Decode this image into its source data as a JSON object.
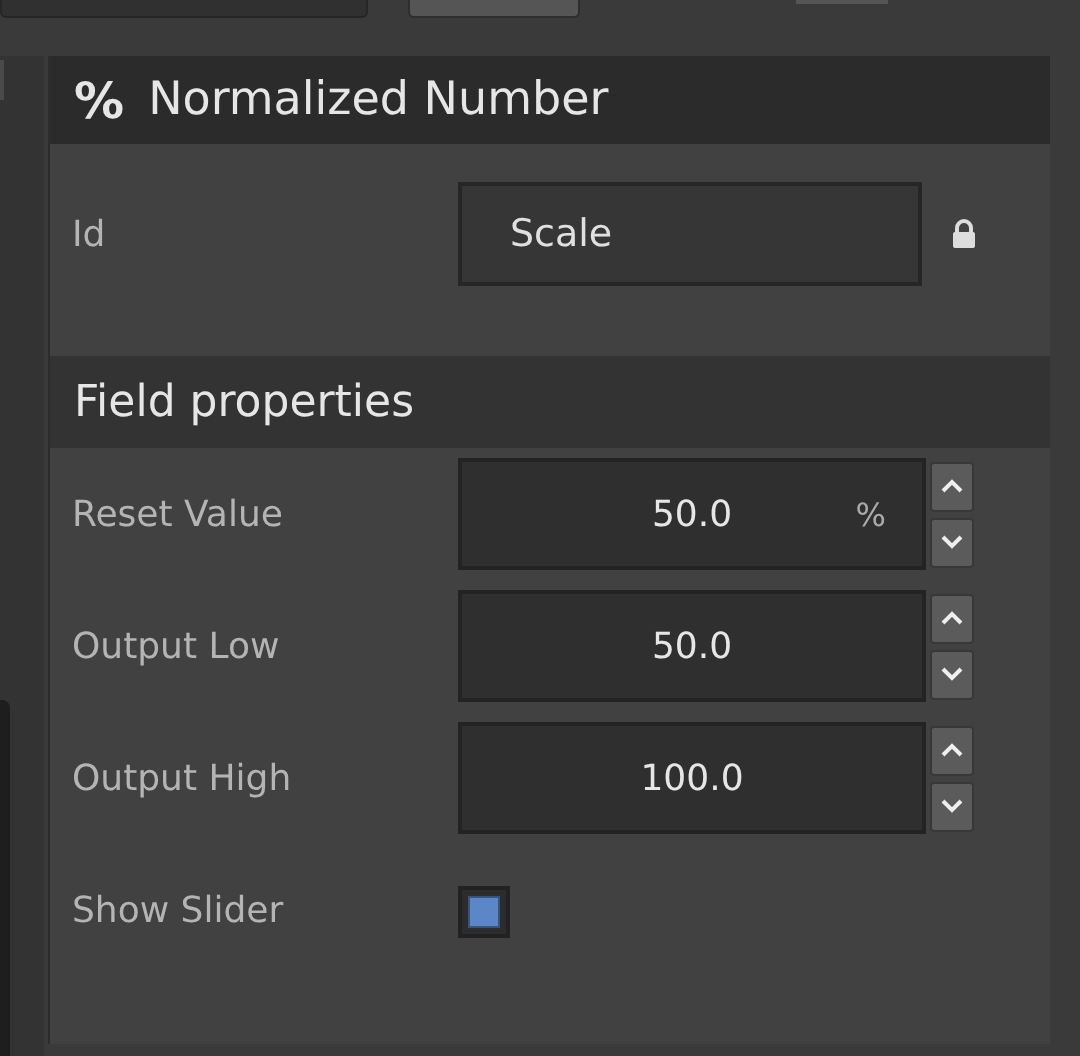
{
  "header": {
    "icon": "%",
    "title": "Normalized Number"
  },
  "id_field": {
    "label": "Id",
    "value": "Scale",
    "locked": true
  },
  "section": {
    "title": "Field properties"
  },
  "fields": [
    {
      "kind": "number",
      "label": "Reset Value",
      "value": "50.0",
      "unit": "%"
    },
    {
      "kind": "number",
      "label": "Output Low",
      "value": "50.0"
    },
    {
      "kind": "number",
      "label": "Output High",
      "value": "100.0"
    },
    {
      "kind": "checkbox",
      "label": "Show Slider",
      "checked": true
    }
  ]
}
